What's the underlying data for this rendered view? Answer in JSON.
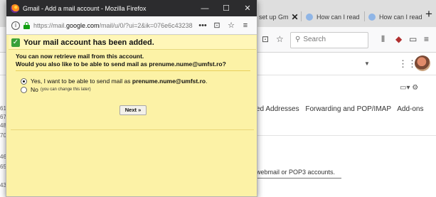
{
  "background": {
    "tabs": [
      {
        "label": "set up Gm"
      },
      {
        "label": "How can I read"
      },
      {
        "label": "How can I read"
      }
    ],
    "toolbar": {
      "search_placeholder": "Search"
    },
    "settings_tabs": [
      "ed Addresses",
      "Forwarding and POP/IMAP",
      "Add-ons"
    ],
    "webmail_text": "webmail or POP3 accounts.",
    "left_numbers": [
      "61",
      "67",
      "48",
      "70",
      "46",
      "65",
      "43"
    ]
  },
  "popup": {
    "window_title": "Gmail - Add a mail account - Mozilla Firefox",
    "url_prefix": "https://mail.",
    "url_domain": "google.com",
    "url_rest": "/mail/u/0/?ui=2&ik=076e6c43238",
    "banner": "Your mail account has been added.",
    "message_line1": "You can now retrieve mail from this account.",
    "message_line2": "Would you also like to be able to send mail as prenume.nume@umfst.ro?",
    "options": {
      "yes_label": "Yes, I want to be able to send mail as",
      "yes_email": "prenume.nume@umfst.ro",
      "yes_selected": true,
      "no_label": "No",
      "no_hint": "(you can change this later)",
      "no_selected": false
    },
    "next_button": "Next »"
  },
  "colors": {
    "popup_background": "#fcf2a6",
    "banner_background": "#fff6b8",
    "check_green": "#39a139",
    "titlebar": "#2c2c2e",
    "lock_green": "#12a012"
  }
}
